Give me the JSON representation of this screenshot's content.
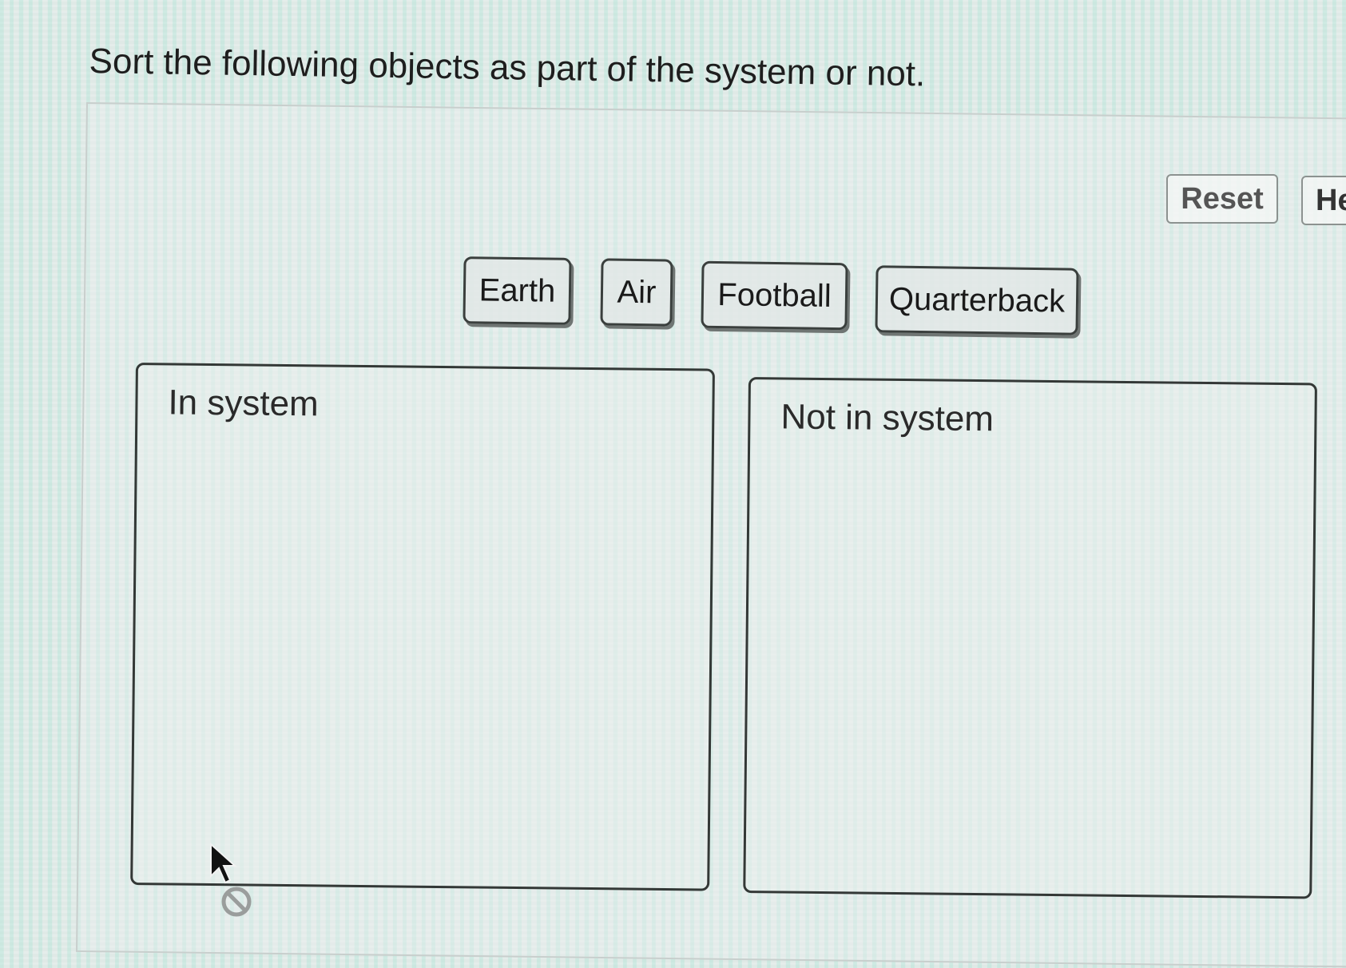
{
  "question": {
    "text": "Sort the following objects as part of the system or not."
  },
  "toolbar": {
    "reset_label": "Reset",
    "help_label": "He"
  },
  "items": [
    {
      "label": "Earth"
    },
    {
      "label": "Air"
    },
    {
      "label": "Football"
    },
    {
      "label": "Quarterback"
    }
  ],
  "zones": {
    "in_system": {
      "label": "In system"
    },
    "not_in_system": {
      "label": "Not in system"
    }
  },
  "icons": {
    "cursor": "arrow-pointer-no-drop-icon"
  },
  "colors": {
    "chip_border": "#3a3f3d",
    "zone_border": "#333836",
    "button_border": "#8c9290"
  }
}
